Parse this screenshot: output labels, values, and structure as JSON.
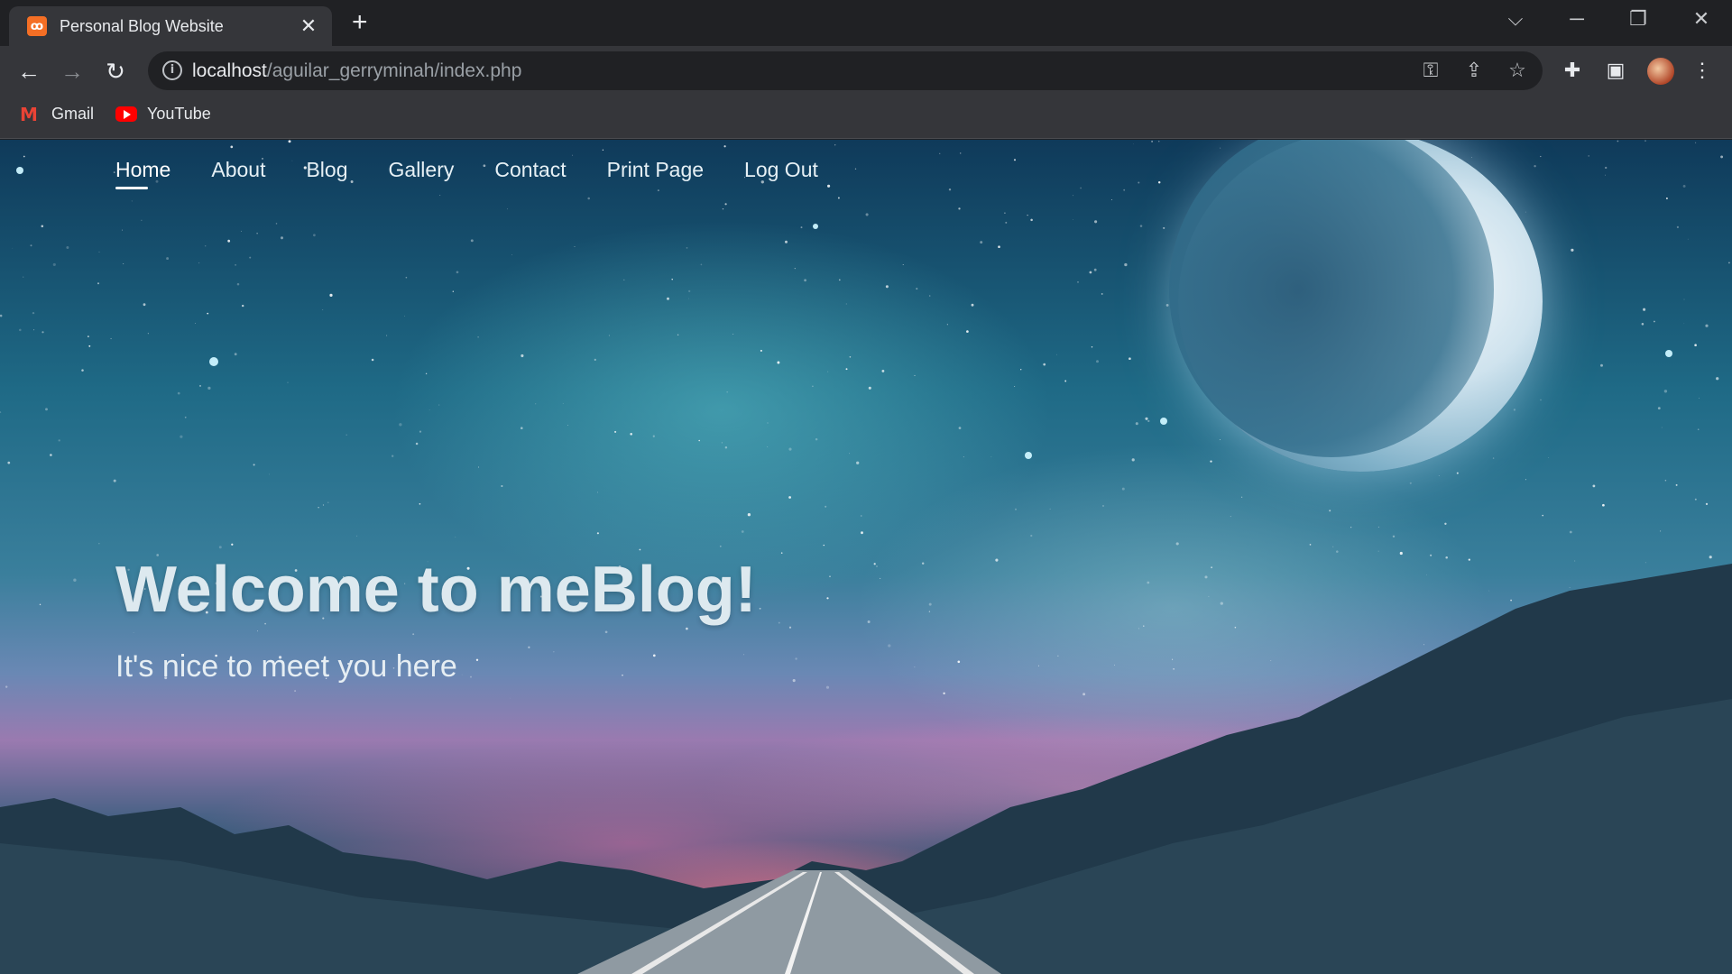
{
  "browser": {
    "tab_title": "Personal Blog Website",
    "favicon_text": "ꝏ",
    "url_host": "localhost",
    "url_path": "/aguilar_gerryminah/index.php",
    "bookmarks": [
      {
        "label": "Gmail",
        "icon": "gmail-icon"
      },
      {
        "label": "YouTube",
        "icon": "youtube-icon"
      }
    ]
  },
  "site": {
    "nav": [
      {
        "label": "Home",
        "active": true
      },
      {
        "label": "About"
      },
      {
        "label": "Blog"
      },
      {
        "label": "Gallery"
      },
      {
        "label": "Contact"
      },
      {
        "label": "Print Page"
      },
      {
        "label": "Log Out"
      }
    ],
    "hero_title": "Welcome to meBlog!",
    "hero_subtitle": "It's nice to meet you here"
  },
  "colors": {
    "chrome_dark": "#202124",
    "chrome_toolbar": "#35363a",
    "favicon_bg": "#f46f25",
    "nav_text": "#e6f0f5"
  }
}
